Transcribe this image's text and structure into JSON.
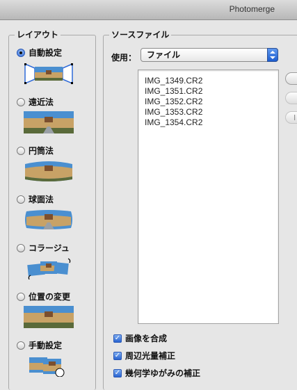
{
  "window": {
    "title": "Photomerge"
  },
  "layout": {
    "label": "レイアウト",
    "options": [
      {
        "label": "自動設定",
        "checked": true,
        "icon": "auto-layout-icon"
      },
      {
        "label": "遠近法",
        "checked": false,
        "icon": "perspective-icon"
      },
      {
        "label": "円筒法",
        "checked": false,
        "icon": "cylindrical-icon"
      },
      {
        "label": "球面法",
        "checked": false,
        "icon": "spherical-icon"
      },
      {
        "label": "コラージュ",
        "checked": false,
        "icon": "collage-icon"
      },
      {
        "label": "位置の変更",
        "checked": false,
        "icon": "reposition-icon"
      },
      {
        "label": "手動設定",
        "checked": false,
        "icon": "interactive-layout-icon"
      }
    ]
  },
  "source": {
    "label": "ソースファイル",
    "use_label": "使用：",
    "use_value": "ファイル",
    "files": [
      "IMG_1349.CR2",
      "IMG_1351.CR2",
      "IMG_1352.CR2",
      "IMG_1353.CR2",
      "IMG_1354.CR2"
    ],
    "side_button_fragment": "I"
  },
  "options": [
    {
      "label": "画像を合成",
      "checked": true
    },
    {
      "label": "周辺光量補正",
      "checked": true
    },
    {
      "label": "幾何学ゆがみの補正",
      "checked": true
    }
  ],
  "colors": {
    "sky": "#4a8fd0",
    "building": "#c8a266",
    "roof": "#7b4f2e",
    "ground": "#5a6a3a",
    "accent": "#2f6ad8"
  }
}
